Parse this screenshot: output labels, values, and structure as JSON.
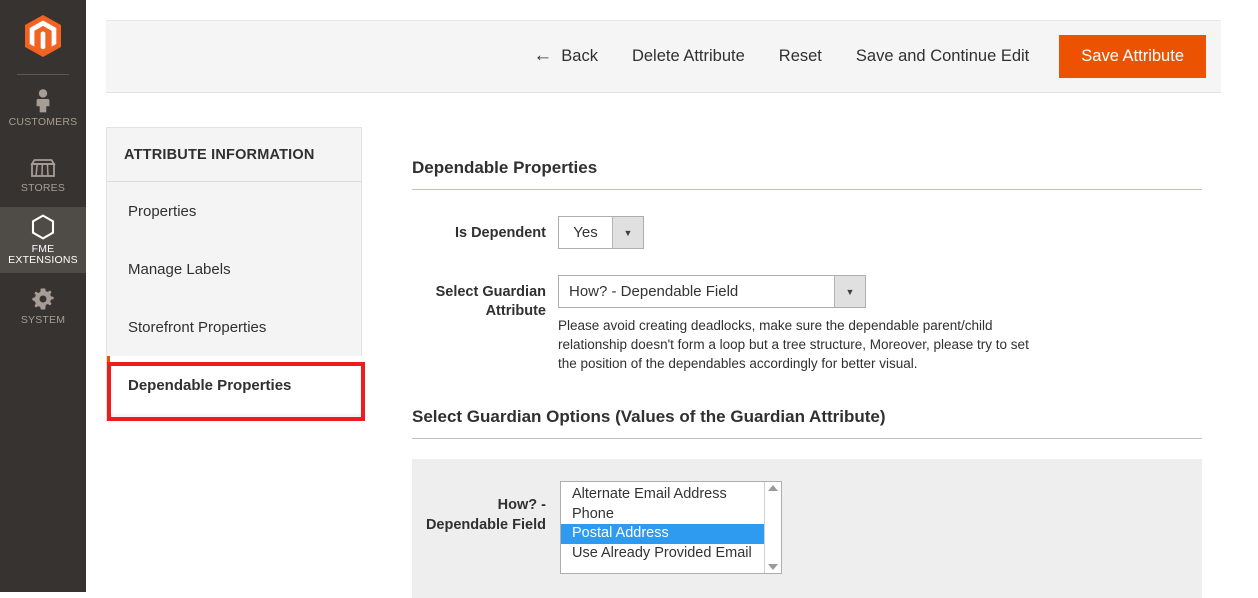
{
  "sidebar": {
    "logo_icon": "magento-logo-icon",
    "items": [
      {
        "label": "CUSTOMERS",
        "icon": "person-icon",
        "active": false
      },
      {
        "label": "STORES",
        "icon": "storefront-icon",
        "active": false
      },
      {
        "label": "FME EXTENSIONS",
        "icon": "hexagon-icon",
        "active": true
      },
      {
        "label": "SYSTEM",
        "icon": "gear-icon",
        "active": false
      }
    ]
  },
  "toolbar": {
    "back_icon": "arrow-left-icon",
    "back_label": "Back",
    "delete_label": "Delete Attribute",
    "reset_label": "Reset",
    "save_continue_label": "Save and Continue Edit",
    "save_label": "Save Attribute",
    "primary_color": "#eb5202"
  },
  "attribute_info": {
    "panel_title": "ATTRIBUTE INFORMATION",
    "items": [
      {
        "label": "Properties"
      },
      {
        "label": "Manage Labels"
      },
      {
        "label": "Storefront Properties"
      },
      {
        "label": "Dependable Properties"
      }
    ],
    "active_index": 3,
    "highlight_color": "#ee1c1c"
  },
  "dependable_properties": {
    "heading": "Dependable Properties",
    "is_dependent": {
      "label": "Is Dependent",
      "value": "Yes",
      "arrow_icon": "chevron-down-icon"
    },
    "guardian_attribute": {
      "label": "Select Guardian Attribute",
      "value": "How? - Dependable Field",
      "arrow_icon": "chevron-down-icon",
      "help": "Please avoid creating deadlocks, make sure the dependable parent/child relationship doesn't form a loop but a tree structure, Moreover, please try to set the position of the dependables accordingly for better visual."
    }
  },
  "guardian_options": {
    "heading": "Select Guardian Options (Values of the Guardian Attribute)",
    "field_label": "How? - Dependable Field",
    "options": [
      {
        "label": "Alternate Email Address",
        "selected": false
      },
      {
        "label": "Phone",
        "selected": false
      },
      {
        "label": "Postal Address",
        "selected": true
      },
      {
        "label": "Use Already Provided Email",
        "selected": false
      }
    ],
    "selected_color": "#2e9bf0",
    "scroll_up_icon": "scroll-up-arrow-icon",
    "scroll_down_icon": "scroll-down-arrow-icon"
  }
}
